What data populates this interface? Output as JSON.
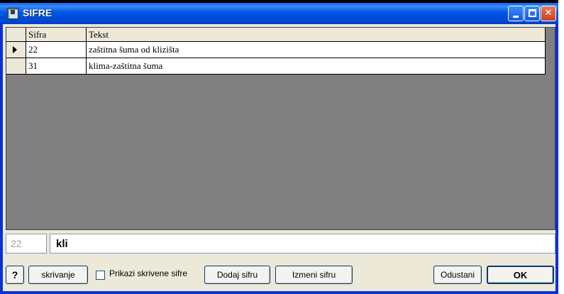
{
  "window": {
    "title": "SIFRE"
  },
  "titlebar_buttons": {
    "minimize": "minimize",
    "maximize": "maximize",
    "close": "✕"
  },
  "grid": {
    "columns": [
      "Sifra",
      "Tekst"
    ],
    "rows": [
      {
        "sifra": "22",
        "tekst": "zaštitna šuma od klizišta",
        "current": true
      },
      {
        "sifra": "31",
        "tekst": "klima-zaštitna šuma",
        "current": false
      }
    ]
  },
  "search": {
    "code": "22",
    "value": "kli"
  },
  "toolbar": {
    "help_label": "?",
    "hide_label": "skrivanje",
    "show_hidden_label": "Prikazi skrivene sifre",
    "show_hidden_checked": false,
    "add_label": "Dodaj sifru",
    "edit_label": "Izmeni sifru",
    "cancel_label": "Odustani",
    "ok_label": "OK"
  }
}
